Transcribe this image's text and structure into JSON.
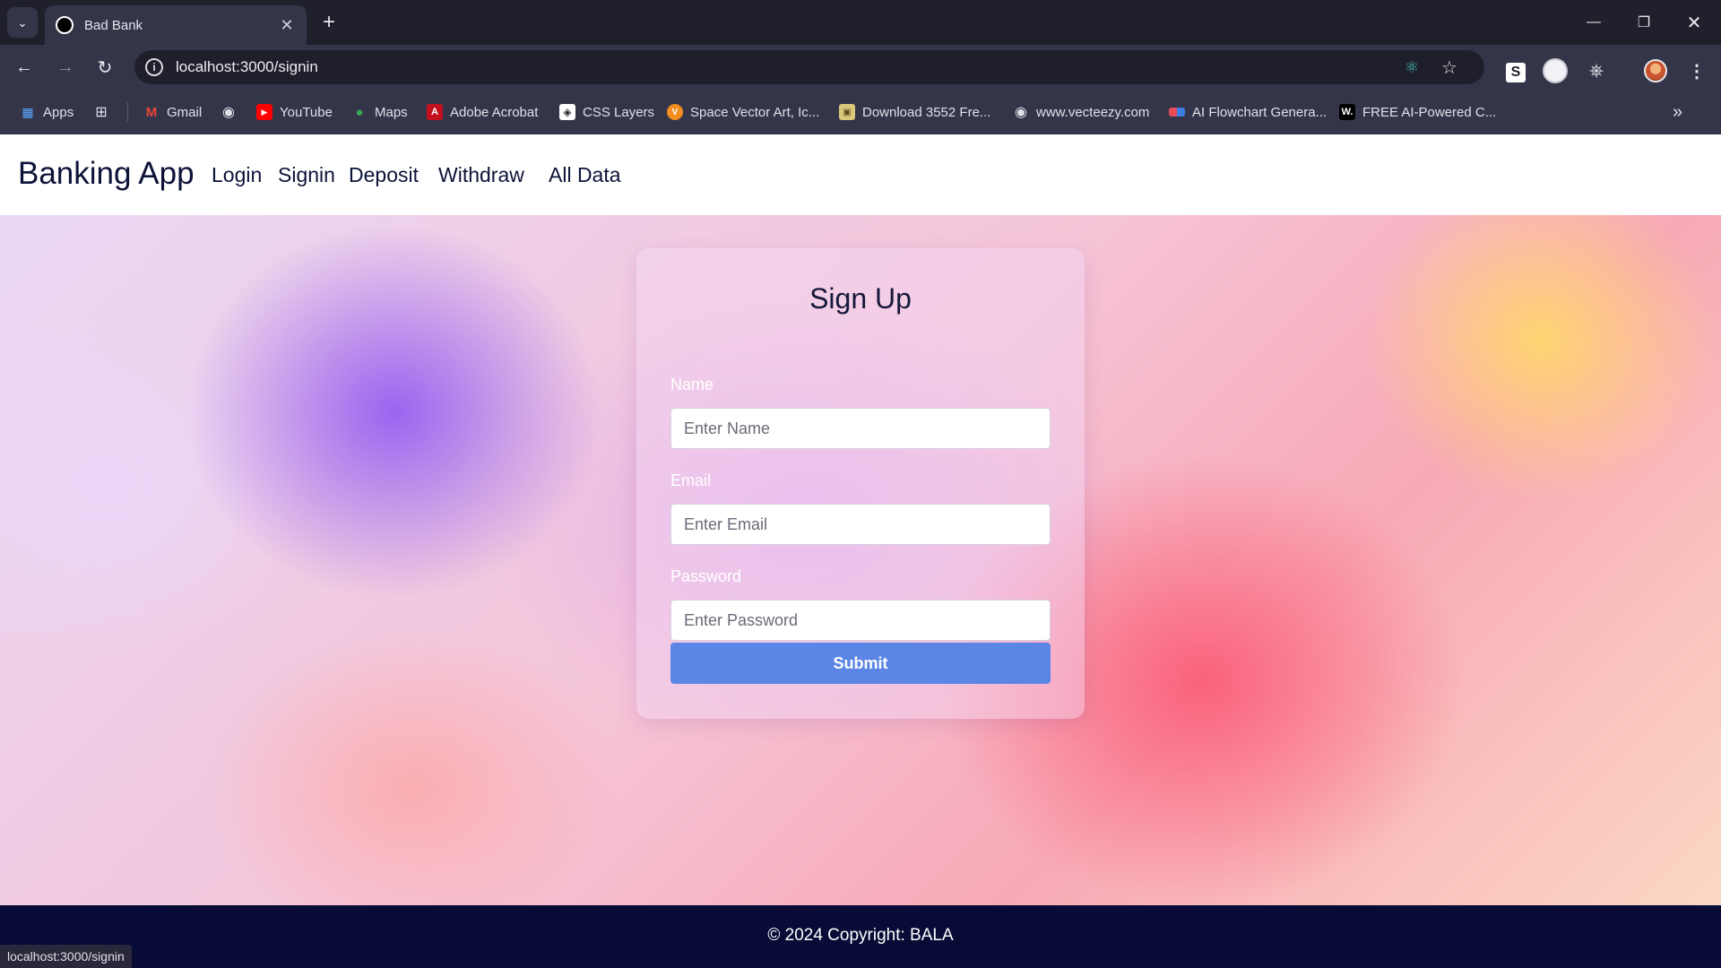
{
  "browser": {
    "tab": {
      "title": "Bad Bank",
      "icon": "circle-favicon-icon"
    },
    "url": "localhost:3000/signin",
    "bookmarks": [
      {
        "label": "Apps",
        "icon": "apps-grid-icon"
      },
      {
        "label": "",
        "icon": "tab-groups-icon"
      },
      {
        "label": "Gmail",
        "icon": "gmail-icon"
      },
      {
        "label": "",
        "icon": "globe-icon"
      },
      {
        "label": "YouTube",
        "icon": "youtube-icon"
      },
      {
        "label": "Maps",
        "icon": "maps-pin-icon"
      },
      {
        "label": "Adobe Acrobat",
        "icon": "acrobat-icon"
      },
      {
        "label": "CSS Layers",
        "icon": "css-layers-icon"
      },
      {
        "label": "Space Vector Art, Ic...",
        "icon": "vector-art-icon"
      },
      {
        "label": "Download 3552 Fre...",
        "icon": "image-icon"
      },
      {
        "label": "www.vecteezy.com",
        "icon": "globe-icon"
      },
      {
        "label": "AI Flowchart Genera...",
        "icon": "flowchart-icon"
      },
      {
        "label": "FREE AI-Powered C...",
        "icon": "w-logo-icon"
      }
    ],
    "status_url": "localhost:3000/signin"
  },
  "app": {
    "brand": "Banking App",
    "nav": [
      "Login",
      "Signin",
      "Deposit",
      "Withdraw",
      "All Data"
    ],
    "form": {
      "title": "Sign Up",
      "name_label": "Name",
      "name_placeholder": "Enter Name",
      "email_label": "Email",
      "email_placeholder": "Enter Email",
      "password_label": "Password",
      "password_placeholder": "Enter Password",
      "submit_label": "Submit"
    },
    "footer": "© 2024 Copyright: BALA"
  },
  "colors": {
    "chrome_dark": "#20202c",
    "chrome_mid": "#35354a",
    "brand_text": "#0d1338",
    "submit_button": "#5b86e5",
    "footer_bg": "#070b36"
  }
}
